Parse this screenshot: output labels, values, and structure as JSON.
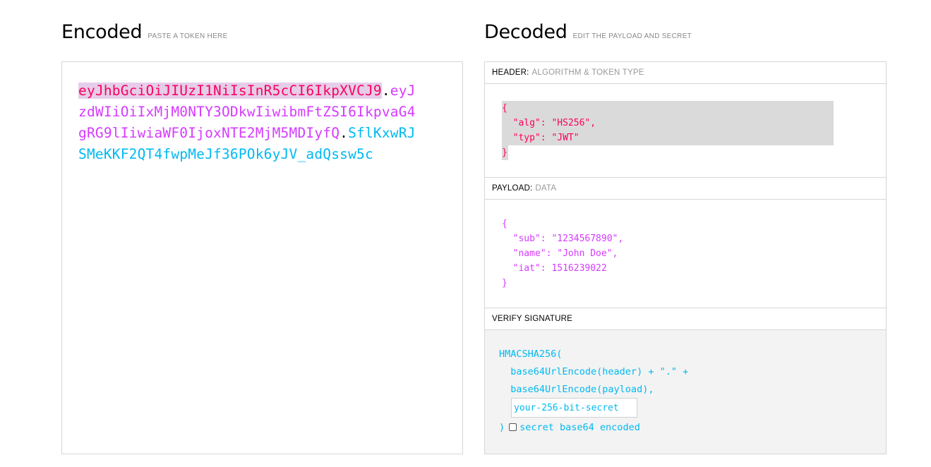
{
  "encoded": {
    "title": "Encoded",
    "subtitle": "PASTE A TOKEN HERE",
    "token_header": "eyJhbGciOiJIUzI1NiIsInR5cCI6IkpXVCJ9",
    "dot1": ".",
    "token_payload": "eyJzdWIiOiIxMjM0NTY3ODkwIiwibmFtZSI6IkpvaG4gRG9lIiwiaWF0IjoxNTE2MjM5MDIyfQ",
    "dot2": ".",
    "token_signature": "SflKxwRJSMeKKF2QT4fwpMeJf36POk6yJV_adQssw5c"
  },
  "decoded": {
    "title": "Decoded",
    "subtitle": "EDIT THE PAYLOAD AND SECRET",
    "header_panel": {
      "label": "HEADER:",
      "sub": "ALGORITHM & TOKEN TYPE",
      "lines": [
        "{",
        "  \"alg\": \"HS256\",",
        "  \"typ\": \"JWT\"",
        "}"
      ]
    },
    "payload_panel": {
      "label": "PAYLOAD:",
      "sub": "DATA",
      "lines": [
        "{",
        "  \"sub\": \"1234567890\",",
        "  \"name\": \"John Doe\",",
        "  \"iat\": 1516239022",
        "}"
      ]
    },
    "verify_panel": {
      "label": "VERIFY SIGNATURE",
      "line1": "HMACSHA256(",
      "line2": "  base64UrlEncode(header) + \".\" +",
      "line3": "  base64UrlEncode(payload),",
      "secret_value": "your-256-bit-secret",
      "close_paren": ")",
      "checkbox_label": "secret base64 encoded"
    }
  },
  "colors": {
    "header": "#fb015b",
    "payload": "#d63aff",
    "signature": "#00b9f1",
    "border": "#d6d6d6"
  }
}
